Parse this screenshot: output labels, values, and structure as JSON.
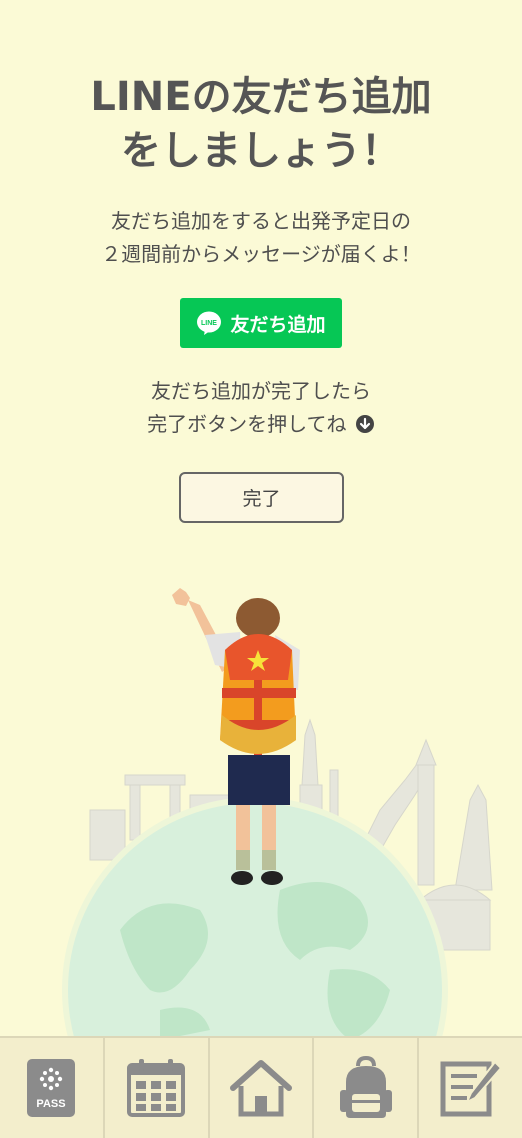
{
  "header": {
    "title_line1": "LINEの友だち追加",
    "title_line2": "をしましょう！"
  },
  "description": {
    "line1": "友だち追加をすると出発予定日の",
    "line2": "２週間前からメッセージが届くよ！"
  },
  "line_button": {
    "logo_text": "LINE",
    "label": "友だち追加",
    "color": "#06c755"
  },
  "instruction": {
    "line1": "友だち追加が完了したら",
    "line2": "完了ボタンを押してね"
  },
  "done_button": {
    "label": "完了"
  },
  "bottom_nav": {
    "pass_label": "PASS",
    "items": [
      "pass-icon",
      "calendar-icon",
      "home-icon",
      "backpack-icon",
      "notepad-icon"
    ]
  },
  "colors": {
    "background": "#fbfad6",
    "nav_background": "#f3eecc",
    "nav_icon": "#8b8b8b"
  }
}
